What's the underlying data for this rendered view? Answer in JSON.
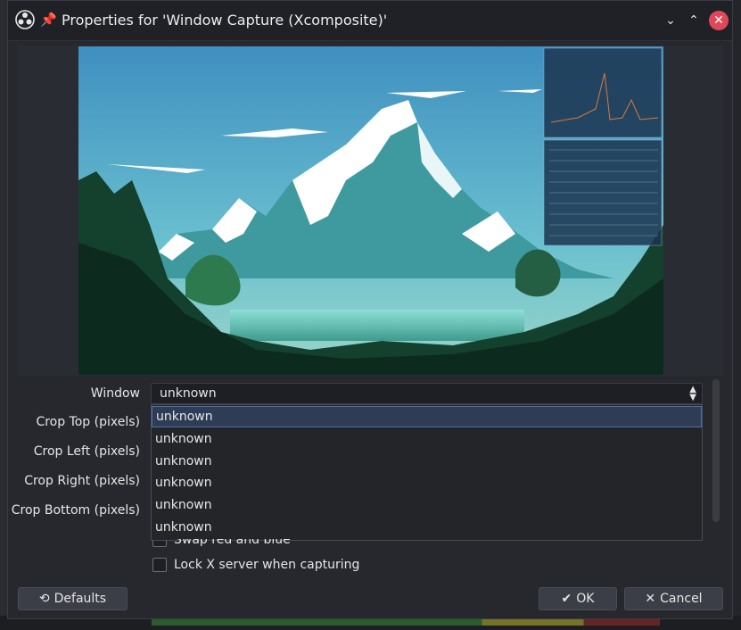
{
  "window": {
    "title": "Properties for 'Window Capture (Xcomposite)'",
    "min_icon": "chevron-down-icon",
    "max_icon": "chevron-up-icon",
    "close_icon": "close-icon",
    "min_glyph": "⌄",
    "max_glyph": "⌃",
    "close_glyph": "✕",
    "pin_glyph": "📌"
  },
  "form": {
    "window_label": "Window",
    "window_value": "unknown",
    "crop_top_label": "Crop Top (pixels)",
    "crop_left_label": "Crop Left (pixels)",
    "crop_right_label": "Crop Right (pixels)",
    "crop_bottom_label": "Crop Bottom (pixels)",
    "dropdown_options": [
      "unknown",
      "unknown",
      "unknown",
      "unknown",
      "unknown",
      "unknown"
    ],
    "swap_label": "Swap red and blue",
    "lock_label": "Lock X server when capturing"
  },
  "buttons": {
    "defaults": "Defaults",
    "ok": "OK",
    "cancel": "Cancel",
    "ok_glyph": "✔",
    "cancel_glyph": "✕",
    "defaults_glyph": "⟲"
  },
  "colors": {
    "accent": "#2e3d55",
    "close_button": "#e0485a",
    "dialog_bg": "#26282e"
  }
}
